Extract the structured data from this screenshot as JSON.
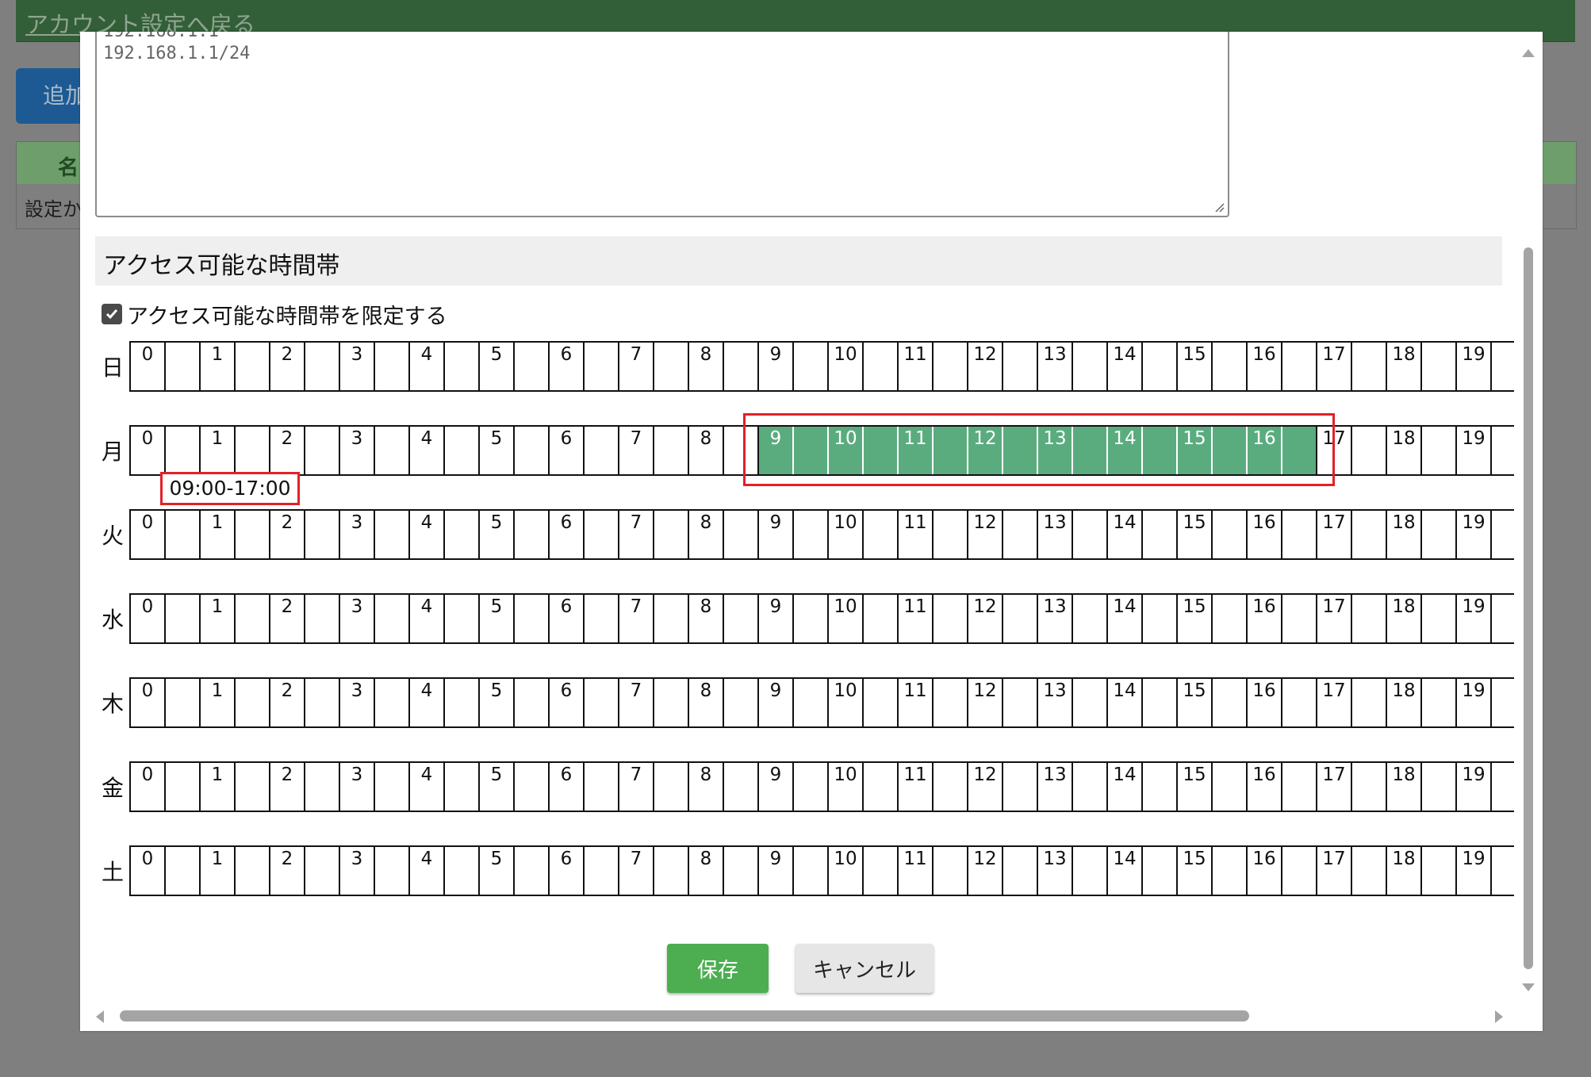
{
  "background": {
    "back_link": "アカウント設定へ戻る",
    "add_button": "追加",
    "table_header": "名",
    "table_row": "設定か"
  },
  "ip_textarea": {
    "lines": [
      "192.168.1.1",
      "192.168.1.1/24"
    ]
  },
  "access_section": {
    "title": "アクセス可能な時間帯",
    "limit_checkbox_label": "アクセス可能な時間帯を限定する",
    "limit_checked": true,
    "days": [
      "日",
      "月",
      "火",
      "水",
      "木",
      "金",
      "土"
    ],
    "hours": [
      "0",
      "1",
      "2",
      "3",
      "4",
      "5",
      "6",
      "7",
      "8",
      "9",
      "10",
      "11",
      "12",
      "13",
      "14",
      "15",
      "16",
      "17",
      "18",
      "19"
    ],
    "selected_day": "月",
    "selected_start_hour": 9,
    "selected_end_hour": 17,
    "selected_range_label": "09:00-17:00",
    "selected_color": "#5aac7e",
    "highlight_color": "#e32028"
  },
  "actions": {
    "save_label": "保存",
    "cancel_label": "キャンセル",
    "save_color": "#4cae50"
  }
}
